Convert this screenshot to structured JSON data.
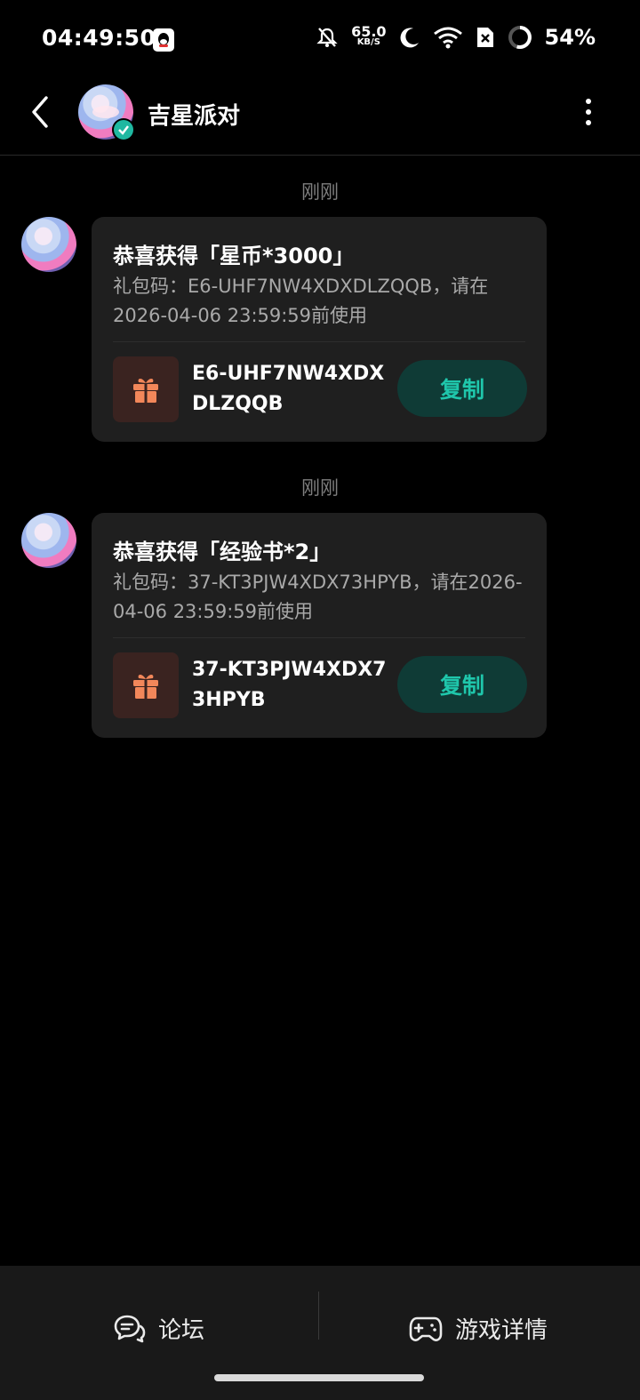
{
  "status": {
    "time": "04:49:50",
    "net_speed": "65.0",
    "net_unit": "KB/S",
    "battery": "54%"
  },
  "header": {
    "title": "吉星派对"
  },
  "messages": [
    {
      "timestamp": "刚刚",
      "title": "恭喜获得「星币*3000」",
      "desc": "礼包码：E6-UHF7NW4XDXDLZQQB，请在2026-04-06 23:59:59前使用",
      "code": "E6-UHF7NW4XDXDLZQQB",
      "copy_label": "复制"
    },
    {
      "timestamp": "刚刚",
      "title": "恭喜获得「经验书*2」",
      "desc": "礼包码：37-KT3PJW4XDX73HPYB，请在2026-04-06 23:59:59前使用",
      "code": "37-KT3PJW4XDX73HPYB",
      "copy_label": "复制"
    }
  ],
  "bottom": {
    "forum_label": "论坛",
    "game_label": "游戏详情"
  },
  "colors": {
    "accent": "#1fc6ab",
    "copy_bg": "#0f3b36",
    "gift_icon": "#f2875a",
    "card_bg": "#1f1f1f"
  }
}
